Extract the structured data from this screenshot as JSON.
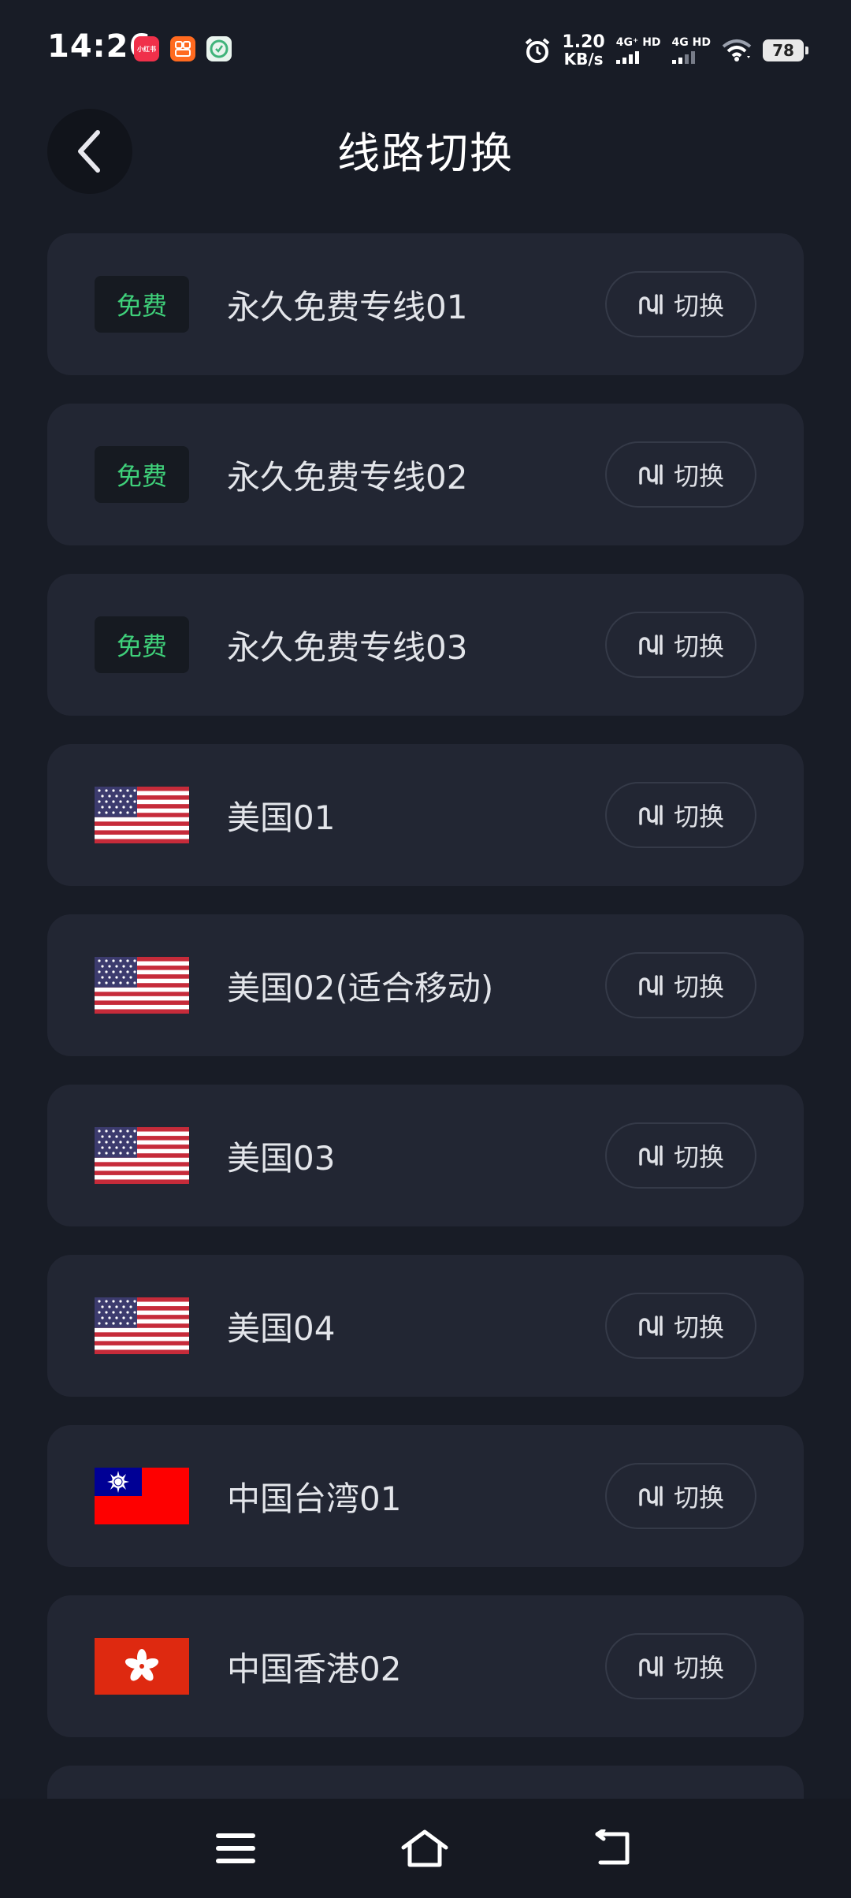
{
  "status_bar": {
    "time": "14:26",
    "app_icons": [
      {
        "name": "xiaohongshu-app-icon",
        "label": "小红书",
        "color": "#f0304a"
      },
      {
        "name": "taobao-app-icon",
        "label": "",
        "color": "#ff6a1f"
      },
      {
        "name": "green-app-icon",
        "label": "",
        "color": "#3fb37a"
      }
    ],
    "net_speed_value": "1.20",
    "net_speed_unit": "KB/s",
    "sim1_label": "4G⁺ HD",
    "sim2_label": "4G HD",
    "battery": "78"
  },
  "header": {
    "title": "线路切换",
    "back_icon": "chevron-left-icon"
  },
  "routes": [
    {
      "badge": "免费",
      "flag": null,
      "name": "永久免费专线01",
      "button": "切换"
    },
    {
      "badge": "免费",
      "flag": null,
      "name": "永久免费专线02",
      "button": "切换"
    },
    {
      "badge": "免费",
      "flag": null,
      "name": "永久免费专线03",
      "button": "切换"
    },
    {
      "badge": null,
      "flag": "us",
      "name": "美国01",
      "button": "切换"
    },
    {
      "badge": null,
      "flag": "us",
      "name": "美国02(适合移动)",
      "button": "切换"
    },
    {
      "badge": null,
      "flag": "us",
      "name": "美国03",
      "button": "切换"
    },
    {
      "badge": null,
      "flag": "us",
      "name": "美国04",
      "button": "切换"
    },
    {
      "badge": null,
      "flag": "tw",
      "name": "中国台湾01",
      "button": "切换"
    },
    {
      "badge": null,
      "flag": "hk",
      "name": "中国香港02",
      "button": "切换"
    }
  ],
  "nav_bar": {
    "icons": [
      "menu-icon",
      "home-icon",
      "back-arrow-icon"
    ]
  },
  "colors": {
    "background": "#181c26",
    "card": "#222633",
    "free_badge_text": "#3fd07a",
    "button_border": "#353a48"
  }
}
